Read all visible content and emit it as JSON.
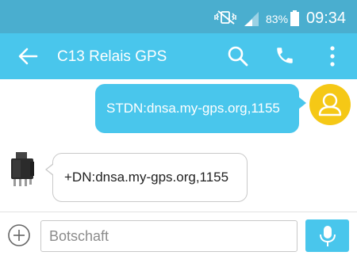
{
  "status_bar": {
    "battery_percent": "83%",
    "battery_level": 0.83,
    "time": "09:34",
    "icons": [
      "vibrate-icon",
      "signal-icon",
      "battery-icon"
    ]
  },
  "app_bar": {
    "title": "C13 Relais GPS",
    "background_color": "#49c6ec",
    "icons": [
      "back-arrow-icon",
      "search-icon",
      "phone-icon",
      "more-vert-icon"
    ]
  },
  "conversation": {
    "messages": [
      {
        "direction": "outgoing",
        "text": "STDN:dnsa.my-gps.org,1155",
        "avatar": "user-avatar-icon"
      },
      {
        "direction": "incoming",
        "text": "+DN:dnsa.my-gps.org,1155",
        "avatar": "relay-device-icon"
      }
    ]
  },
  "composer": {
    "placeholder": "Botschaft",
    "value": "",
    "icons": [
      "add-attachment-icon",
      "microphone-icon"
    ]
  },
  "colors": {
    "status_bar": "#4aaecf",
    "accent": "#49c6ec",
    "avatar": "#f5c816"
  }
}
